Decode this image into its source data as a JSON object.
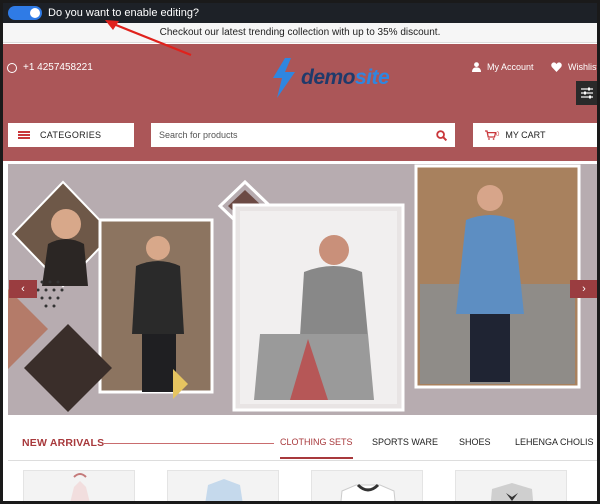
{
  "editing": {
    "label": "Do you want to enable editing?",
    "enabled": true,
    "toggle_color": "#2f7be6"
  },
  "promo": {
    "text": "Checkout our latest trending collection with up to 35% discount."
  },
  "header": {
    "bg_color": "#ab5658",
    "phone": "+1 4257458221",
    "logo": {
      "part1": "demo",
      "part2": "site"
    },
    "account_label": "My Account",
    "wishlist_label": "Wishlist"
  },
  "nav": {
    "categories_label": "CATEGORIES",
    "search_placeholder": "Search for products",
    "cart_label": "MY CART",
    "cart_count": "0"
  },
  "banner": {
    "prev": "‹",
    "next": "›"
  },
  "arrivals": {
    "title": "NEW ARRIVALS",
    "tabs": [
      "CLOTHING SETS",
      "SPORTS WARE",
      "SHOES",
      "LEHENGA CHOLIS"
    ],
    "active_tab": 0
  }
}
